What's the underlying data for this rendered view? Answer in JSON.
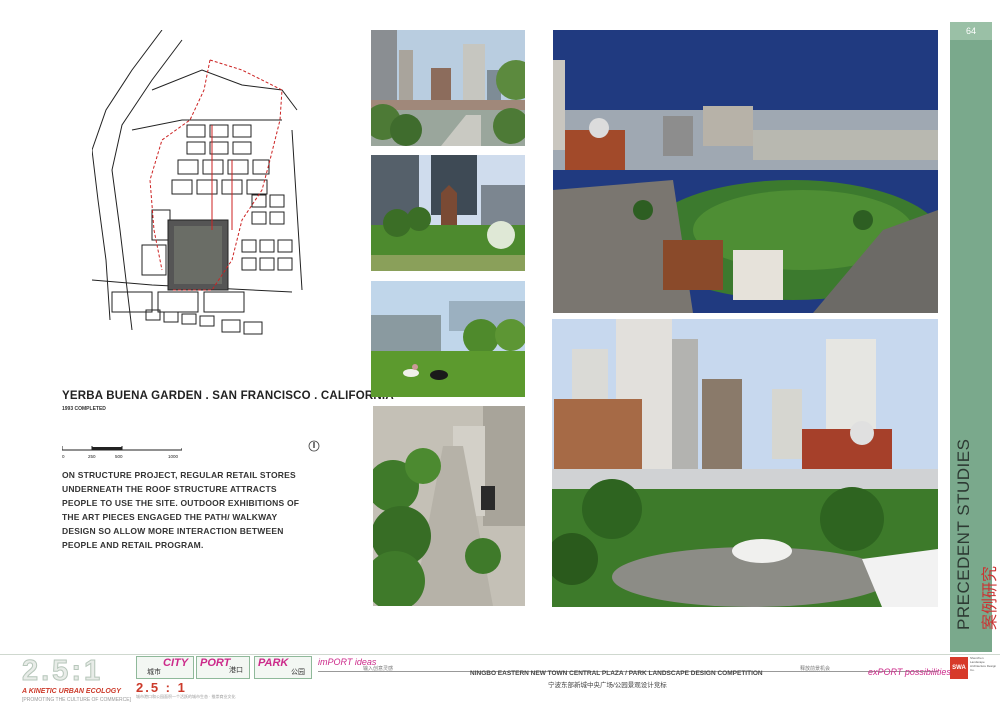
{
  "page": {
    "number": "64",
    "section_title_en": "PRECEDENT STUDIES",
    "section_title_cn": "案例研究"
  },
  "project": {
    "title": "YERBA BUENA GARDEN . SAN FRANCISCO . CALIFORNIA",
    "year": "1993 COMPLETED",
    "description": "ON STRUCTURE PROJECT, REGULAR RETAIL STORES UNDERNEATH THE ROOF STRUCTURE ATTRACTS PEOPLE TO USE THE SITE. OUTDOOR EXHIBITIONS OF THE ART PIECES ENGAGED THE PATH/ WALKWAY DESIGN SO ALLOW MORE INTERACTION BETWEEN PEOPLE AND RETAIL PROGRAM."
  },
  "scale_bar": {
    "labels": [
      "0",
      "250",
      "500",
      "1000"
    ]
  },
  "photos": [
    {
      "name": "photo-city-street"
    },
    {
      "name": "photo-church-lawn"
    },
    {
      "name": "photo-people-lawn"
    },
    {
      "name": "photo-walkway"
    },
    {
      "name": "photo-aerial-garden"
    },
    {
      "name": "photo-concert-crowd"
    }
  ],
  "footer": {
    "logo_big": "2.5:1",
    "logo_tagline": "A KINETIC URBAN ECOLOGY",
    "logo_tagline2": "[PROMOTING THE CULTURE OF COMMERCE]",
    "logo_small": "2.5 : 1",
    "logo_small_cn": "城市港口和公园面积一个活跃的城市生态 · 推崇商业文化",
    "tags": [
      {
        "en": "CITY",
        "cn": "城市"
      },
      {
        "en": "PORT",
        "cn": "港口"
      },
      {
        "en": "PARK",
        "cn": "公园"
      }
    ],
    "import_label": "imPORT ideas",
    "import_cn": "输入创意灵感",
    "competition_en": "NINGBO EASTERN NEW TOWN CENTRAL PLAZA / PARK LANDSCAPE DESIGN COMPETITION",
    "competition_cn": "宁波东部新城中央广场/公园景观设计竞标",
    "export_cn": "释放前景机会",
    "export_label": "exPORT possibilities",
    "swa_logo": "SWA",
    "swa_text": "Shenzhen Landscape Architecture Design Co."
  },
  "colors": {
    "side_band": "#7aa98c",
    "accent_red": "#cc3a2a",
    "accent_magenta": "#cc2a8a"
  }
}
